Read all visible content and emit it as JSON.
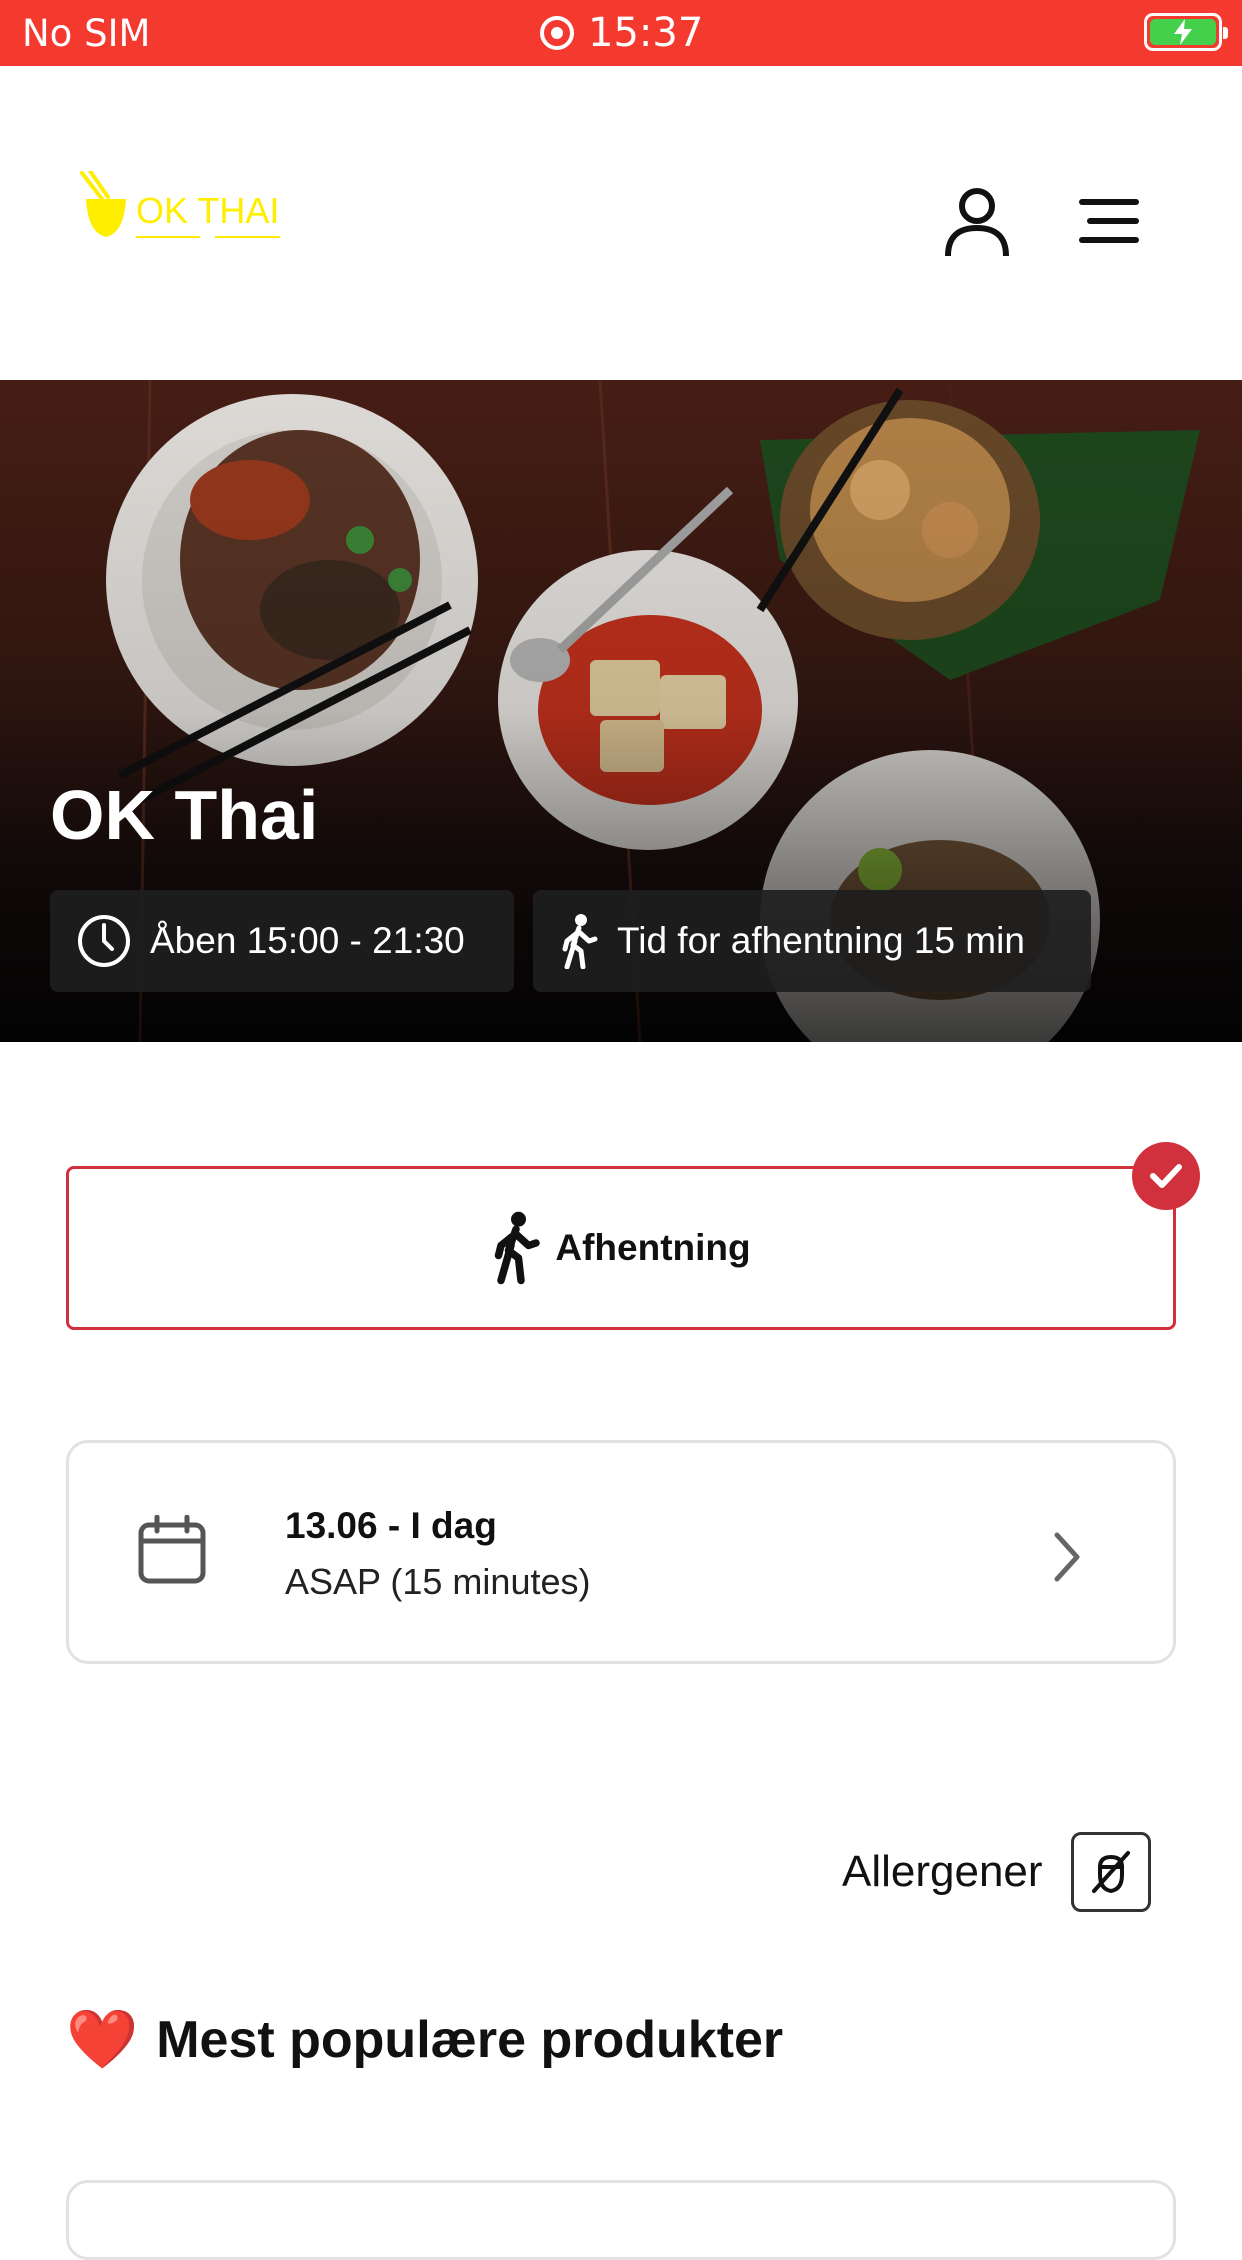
{
  "status_bar": {
    "carrier": "No SIM",
    "time": "15:37",
    "battery_icon": "battery-charging-icon"
  },
  "header": {
    "logo_text": "OK THAI",
    "account_icon": "user-icon",
    "menu_icon": "hamburger-menu-icon"
  },
  "hero": {
    "title": "OK Thai",
    "opening_hours": "Åben 15:00 - 21:30",
    "pickup_time": "Tid for afhentning 15 min"
  },
  "order_type": {
    "label": "Afhentning",
    "selected": true
  },
  "schedule": {
    "date": "13.06 - I dag",
    "time": "ASAP (15 minutes)"
  },
  "allergens": {
    "label": "Allergener"
  },
  "popular": {
    "title": "Mest populære produkter",
    "emoji": "❤️"
  },
  "colors": {
    "status_bar": "#f4392f",
    "accent": "#d1303d",
    "logo": "#ffee00"
  }
}
